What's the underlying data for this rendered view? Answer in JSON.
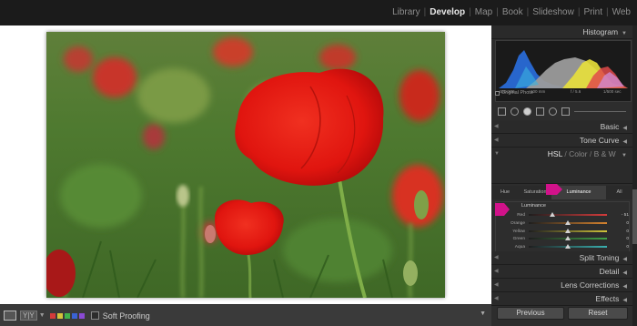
{
  "modules": {
    "items": [
      "Library",
      "Develop",
      "Map",
      "Book",
      "Slideshow",
      "Print",
      "Web"
    ],
    "active": "Develop"
  },
  "panel": {
    "histogram_title": "Histogram",
    "histogram_info": {
      "iso": "ISO 200",
      "focal": "100 mm",
      "aperture": "f / 5.6",
      "shutter": "1/500 sec"
    },
    "original_photo_label": "Original Photo",
    "sections": {
      "basic": "Basic",
      "tone_curve": "Tone Curve",
      "split_toning": "Split Toning",
      "detail": "Detail",
      "lens_corrections": "Lens Corrections",
      "effects": "Effects"
    },
    "hsl_header": {
      "hsl": "HSL",
      "sep1": "/",
      "color": "Color",
      "sep2": "/",
      "bw": "B & W"
    },
    "hsl_tabs": [
      "Hue",
      "Saturation",
      "Luminance",
      "All"
    ],
    "hsl_active_tab": "Luminance",
    "luminance_title": "Luminance",
    "sliders": [
      {
        "name": "Red",
        "value": "- 51",
        "level": 0.3,
        "color": "#d23b3b"
      },
      {
        "name": "Orange",
        "value": "0",
        "level": 0.5,
        "color": "#d4822e"
      },
      {
        "name": "Yellow",
        "value": "0",
        "level": 0.5,
        "color": "#d0c23a"
      },
      {
        "name": "Green",
        "value": "0",
        "level": 0.5,
        "color": "#3fa348"
      },
      {
        "name": "Aqua",
        "value": "0",
        "level": 0.5,
        "color": "#3ab1b0"
      },
      {
        "name": "Blue",
        "value": "0",
        "level": 0.5,
        "color": "#3a5fc9"
      },
      {
        "name": "Purple",
        "value": "0",
        "level": 0.5,
        "color": "#8a49c4"
      },
      {
        "name": "Magenta",
        "value": "0",
        "level": 0.5,
        "color": "#c546a6"
      }
    ],
    "previous_button": "Previous",
    "reset_button": "Reset"
  },
  "toolbar": {
    "compare_label": "Y|Y",
    "soft_proofing_label": "Soft Proofing",
    "swatch_colors": [
      "#d43a3a",
      "#d4c43a",
      "#3fb34a",
      "#3a62d4",
      "#8a4ad4"
    ]
  },
  "colors": {
    "marker": "#d1128a",
    "accent_red": "#e01818"
  }
}
